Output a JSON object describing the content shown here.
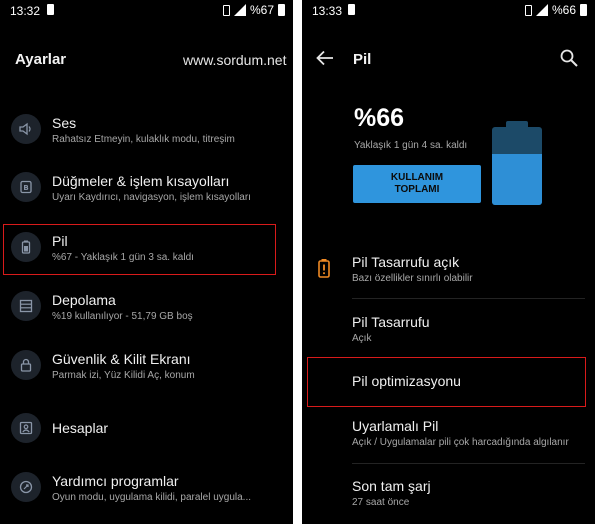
{
  "left_screen": {
    "status": {
      "time": "13:32",
      "battery_text": "%67"
    },
    "title": "Ayarlar",
    "watermark": "www.sordum.net",
    "items": [
      {
        "icon": "volume-icon",
        "title": "Ses",
        "subtitle": "Rahatsız Etmeyin, kulaklık modu, titreşim"
      },
      {
        "icon": "buttons-icon",
        "title": "Düğmeler & işlem kısayolları",
        "subtitle": "Uyarı Kaydırıcı, navigasyon, işlem kısayolları"
      },
      {
        "icon": "battery-icon",
        "title": "Pil",
        "subtitle": "%67 - Yaklaşık 1 gün 3 sa. kaldı"
      },
      {
        "icon": "storage-icon",
        "title": "Depolama",
        "subtitle": "%19 kullanılıyor - 51,79 GB boş"
      },
      {
        "icon": "lock-icon",
        "title": "Güvenlik & Kilit Ekranı",
        "subtitle": "Parmak izi, Yüz Kilidi Aç, konum"
      },
      {
        "icon": "account-icon",
        "title": "Hesaplar",
        "subtitle": ""
      },
      {
        "icon": "utilities-icon",
        "title": "Yardımcı programlar",
        "subtitle": "Oyun modu, uygulama kilidi, paralel uygula..."
      }
    ]
  },
  "right_screen": {
    "status": {
      "time": "13:33",
      "battery_text": "%66"
    },
    "title": "Pil",
    "battery": {
      "percent_text": "%66",
      "level": 0.66,
      "remaining": "Yaklaşık 1 gün 4 sa. kaldı",
      "usage_button_line1": "KULLANIM",
      "usage_button_line2": "TOPLAMI"
    },
    "items": [
      {
        "icon": "battery-alert-icon",
        "title": "Pil Tasarrufu açık",
        "subtitle": "Bazı özellikler sınırlı olabilir"
      },
      {
        "title": "Pil Tasarrufu",
        "subtitle": "Açık"
      },
      {
        "title": "Pil optimizasyonu",
        "subtitle": ""
      },
      {
        "title": "Uyarlamalı Pil",
        "subtitle": "Açık / Uygulamalar pili çok harcadığında algılanır"
      },
      {
        "title": "Son tam şarj",
        "subtitle": "27 saat önce"
      }
    ]
  },
  "colors": {
    "accent": "#2f95dd",
    "highlight": "#d81b1b",
    "alert_icon": "#f08a24",
    "background": "#000000"
  }
}
